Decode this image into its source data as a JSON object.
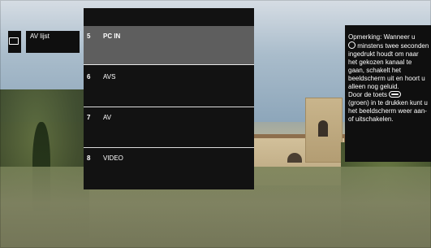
{
  "source": {
    "icon": "monitor-icon",
    "label": "AV lijst"
  },
  "menu": {
    "items": [
      {
        "number": "5",
        "label": "PC IN",
        "selected": true
      },
      {
        "number": "6",
        "label": "AVS",
        "selected": false
      },
      {
        "number": "7",
        "label": "AV",
        "selected": false
      },
      {
        "number": "8",
        "label": "VIDEO",
        "selected": false
      }
    ]
  },
  "note": {
    "part1": "Opmerking: Wanneer u",
    "part2": "minstens twee seconden ingedrukt houdt om naar het gekozen kanaal te gaan, schakelt het beeldscherm uit en hoort u alleen nog geluid.",
    "part3": "Door de toets",
    "part4": "(groen) in te drukken kunt u het beeldscherm weer aan- of uitschakelen.",
    "icon_ok": "ok-icon",
    "icon_bar": "bar-button-icon"
  },
  "colors": {
    "panel_dark": "#121212",
    "selected_bg": "#5e5e5e",
    "text": "#ffffff"
  }
}
